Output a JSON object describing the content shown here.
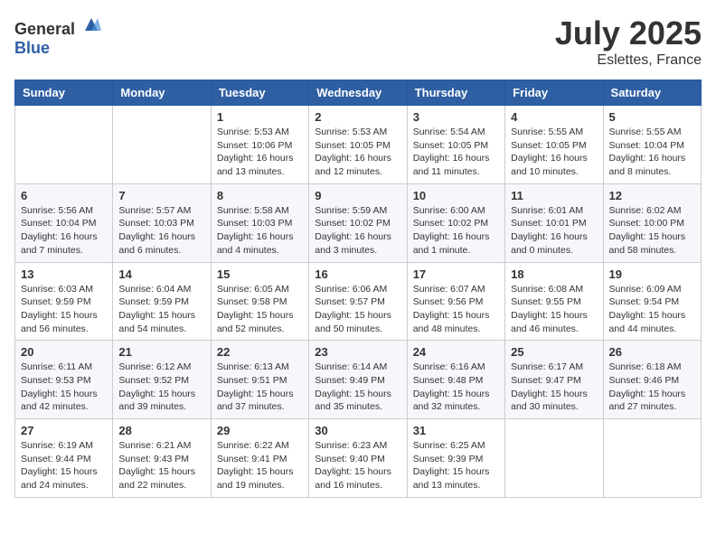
{
  "header": {
    "logo_general": "General",
    "logo_blue": "Blue",
    "month": "July 2025",
    "location": "Eslettes, France"
  },
  "weekdays": [
    "Sunday",
    "Monday",
    "Tuesday",
    "Wednesday",
    "Thursday",
    "Friday",
    "Saturday"
  ],
  "weeks": [
    [
      {
        "day": "",
        "info": ""
      },
      {
        "day": "",
        "info": ""
      },
      {
        "day": "1",
        "info": "Sunrise: 5:53 AM\nSunset: 10:06 PM\nDaylight: 16 hours and 13 minutes."
      },
      {
        "day": "2",
        "info": "Sunrise: 5:53 AM\nSunset: 10:05 PM\nDaylight: 16 hours and 12 minutes."
      },
      {
        "day": "3",
        "info": "Sunrise: 5:54 AM\nSunset: 10:05 PM\nDaylight: 16 hours and 11 minutes."
      },
      {
        "day": "4",
        "info": "Sunrise: 5:55 AM\nSunset: 10:05 PM\nDaylight: 16 hours and 10 minutes."
      },
      {
        "day": "5",
        "info": "Sunrise: 5:55 AM\nSunset: 10:04 PM\nDaylight: 16 hours and 8 minutes."
      }
    ],
    [
      {
        "day": "6",
        "info": "Sunrise: 5:56 AM\nSunset: 10:04 PM\nDaylight: 16 hours and 7 minutes."
      },
      {
        "day": "7",
        "info": "Sunrise: 5:57 AM\nSunset: 10:03 PM\nDaylight: 16 hours and 6 minutes."
      },
      {
        "day": "8",
        "info": "Sunrise: 5:58 AM\nSunset: 10:03 PM\nDaylight: 16 hours and 4 minutes."
      },
      {
        "day": "9",
        "info": "Sunrise: 5:59 AM\nSunset: 10:02 PM\nDaylight: 16 hours and 3 minutes."
      },
      {
        "day": "10",
        "info": "Sunrise: 6:00 AM\nSunset: 10:02 PM\nDaylight: 16 hours and 1 minute."
      },
      {
        "day": "11",
        "info": "Sunrise: 6:01 AM\nSunset: 10:01 PM\nDaylight: 16 hours and 0 minutes."
      },
      {
        "day": "12",
        "info": "Sunrise: 6:02 AM\nSunset: 10:00 PM\nDaylight: 15 hours and 58 minutes."
      }
    ],
    [
      {
        "day": "13",
        "info": "Sunrise: 6:03 AM\nSunset: 9:59 PM\nDaylight: 15 hours and 56 minutes."
      },
      {
        "day": "14",
        "info": "Sunrise: 6:04 AM\nSunset: 9:59 PM\nDaylight: 15 hours and 54 minutes."
      },
      {
        "day": "15",
        "info": "Sunrise: 6:05 AM\nSunset: 9:58 PM\nDaylight: 15 hours and 52 minutes."
      },
      {
        "day": "16",
        "info": "Sunrise: 6:06 AM\nSunset: 9:57 PM\nDaylight: 15 hours and 50 minutes."
      },
      {
        "day": "17",
        "info": "Sunrise: 6:07 AM\nSunset: 9:56 PM\nDaylight: 15 hours and 48 minutes."
      },
      {
        "day": "18",
        "info": "Sunrise: 6:08 AM\nSunset: 9:55 PM\nDaylight: 15 hours and 46 minutes."
      },
      {
        "day": "19",
        "info": "Sunrise: 6:09 AM\nSunset: 9:54 PM\nDaylight: 15 hours and 44 minutes."
      }
    ],
    [
      {
        "day": "20",
        "info": "Sunrise: 6:11 AM\nSunset: 9:53 PM\nDaylight: 15 hours and 42 minutes."
      },
      {
        "day": "21",
        "info": "Sunrise: 6:12 AM\nSunset: 9:52 PM\nDaylight: 15 hours and 39 minutes."
      },
      {
        "day": "22",
        "info": "Sunrise: 6:13 AM\nSunset: 9:51 PM\nDaylight: 15 hours and 37 minutes."
      },
      {
        "day": "23",
        "info": "Sunrise: 6:14 AM\nSunset: 9:49 PM\nDaylight: 15 hours and 35 minutes."
      },
      {
        "day": "24",
        "info": "Sunrise: 6:16 AM\nSunset: 9:48 PM\nDaylight: 15 hours and 32 minutes."
      },
      {
        "day": "25",
        "info": "Sunrise: 6:17 AM\nSunset: 9:47 PM\nDaylight: 15 hours and 30 minutes."
      },
      {
        "day": "26",
        "info": "Sunrise: 6:18 AM\nSunset: 9:46 PM\nDaylight: 15 hours and 27 minutes."
      }
    ],
    [
      {
        "day": "27",
        "info": "Sunrise: 6:19 AM\nSunset: 9:44 PM\nDaylight: 15 hours and 24 minutes."
      },
      {
        "day": "28",
        "info": "Sunrise: 6:21 AM\nSunset: 9:43 PM\nDaylight: 15 hours and 22 minutes."
      },
      {
        "day": "29",
        "info": "Sunrise: 6:22 AM\nSunset: 9:41 PM\nDaylight: 15 hours and 19 minutes."
      },
      {
        "day": "30",
        "info": "Sunrise: 6:23 AM\nSunset: 9:40 PM\nDaylight: 15 hours and 16 minutes."
      },
      {
        "day": "31",
        "info": "Sunrise: 6:25 AM\nSunset: 9:39 PM\nDaylight: 15 hours and 13 minutes."
      },
      {
        "day": "",
        "info": ""
      },
      {
        "day": "",
        "info": ""
      }
    ]
  ]
}
